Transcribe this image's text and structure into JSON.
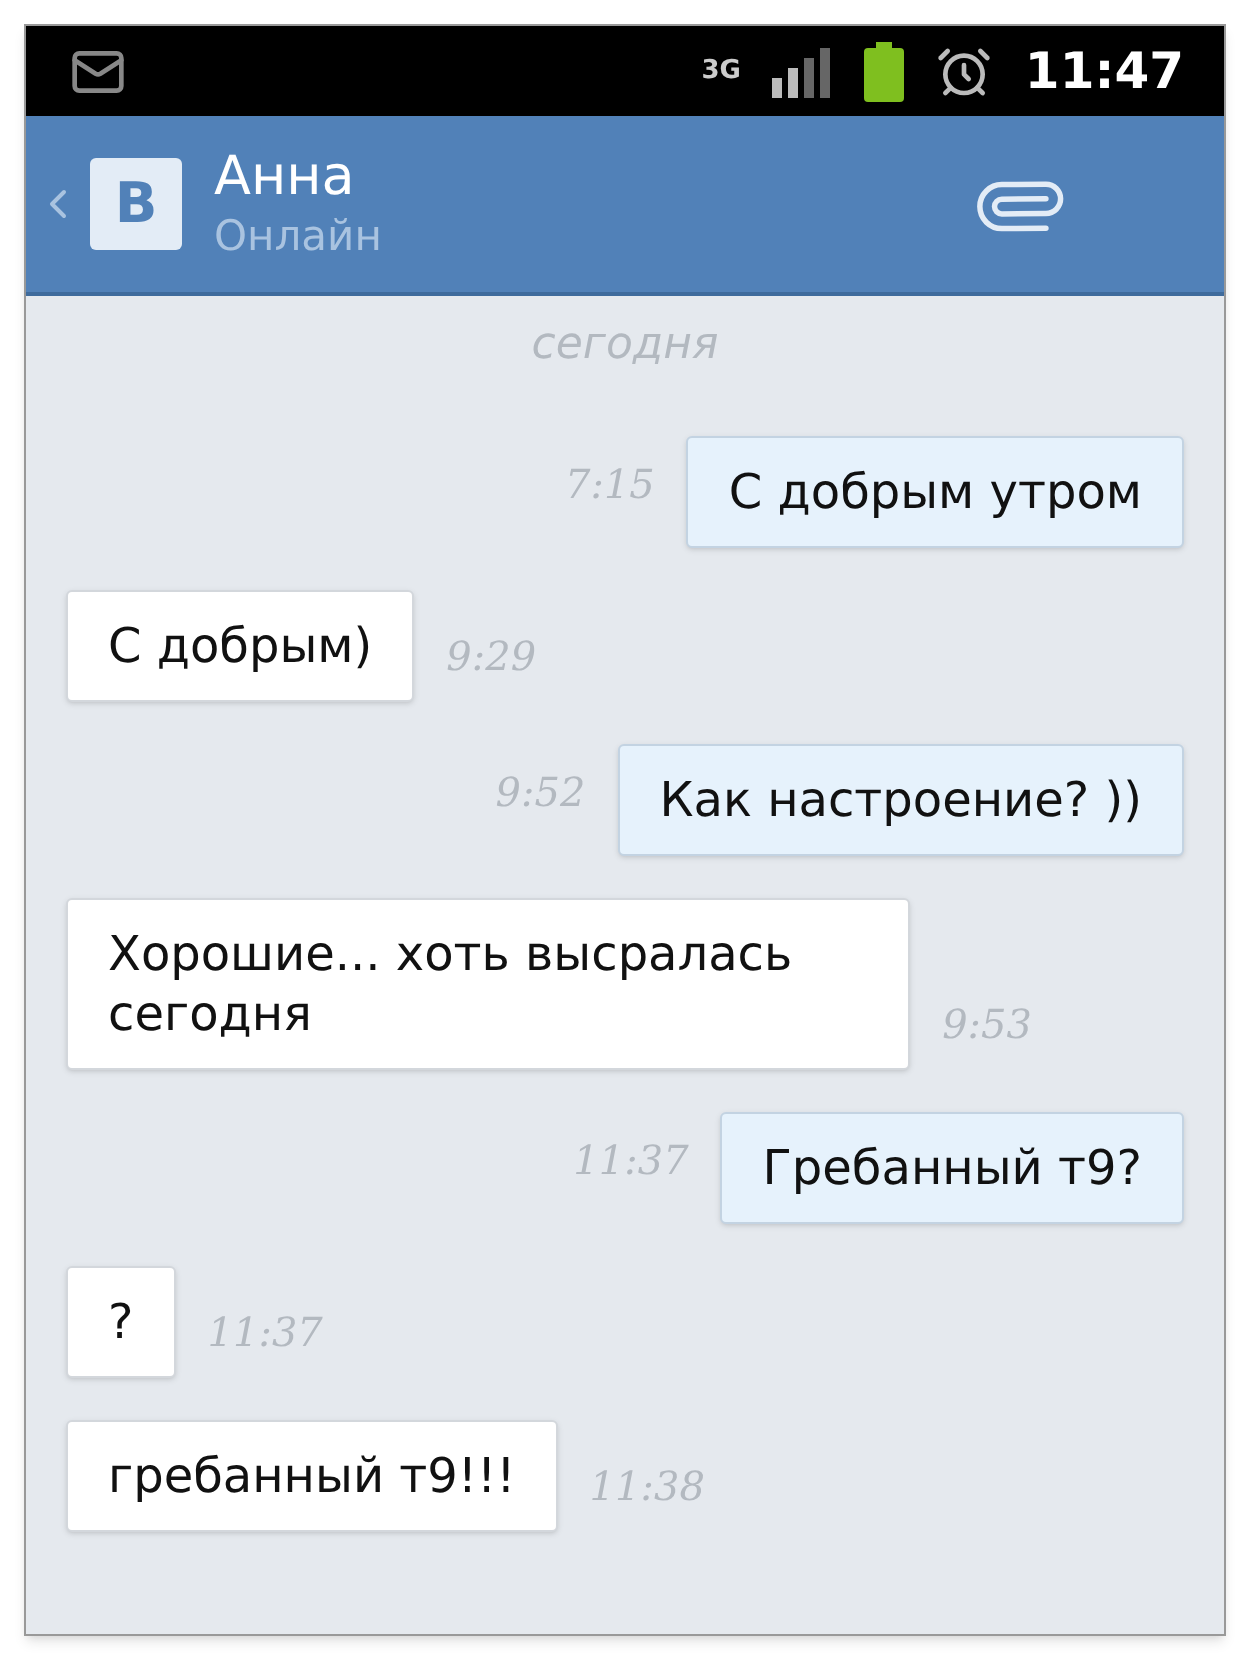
{
  "status_bar": {
    "network": "3G",
    "time": "11:47"
  },
  "header": {
    "logo": "B",
    "name": "Анна",
    "status": "Онлайн"
  },
  "date_divider": "сегодня",
  "messages": [
    {
      "kind": "outgoing",
      "text": "С добрым утром",
      "time": "7:15"
    },
    {
      "kind": "incoming",
      "text": "С добрым)",
      "time": "9:29"
    },
    {
      "kind": "outgoing",
      "text": "Как настроение? ))",
      "time": "9:52"
    },
    {
      "kind": "incoming",
      "text": "Хорошие... хоть высралась сегодня",
      "time": "9:53"
    },
    {
      "kind": "outgoing",
      "text": "Гребанный т9?",
      "time": "11:37"
    },
    {
      "kind": "incoming",
      "text": "?",
      "time": "11:37"
    },
    {
      "kind": "incoming",
      "text": "гребанный т9!!!",
      "time": "11:38"
    }
  ]
}
